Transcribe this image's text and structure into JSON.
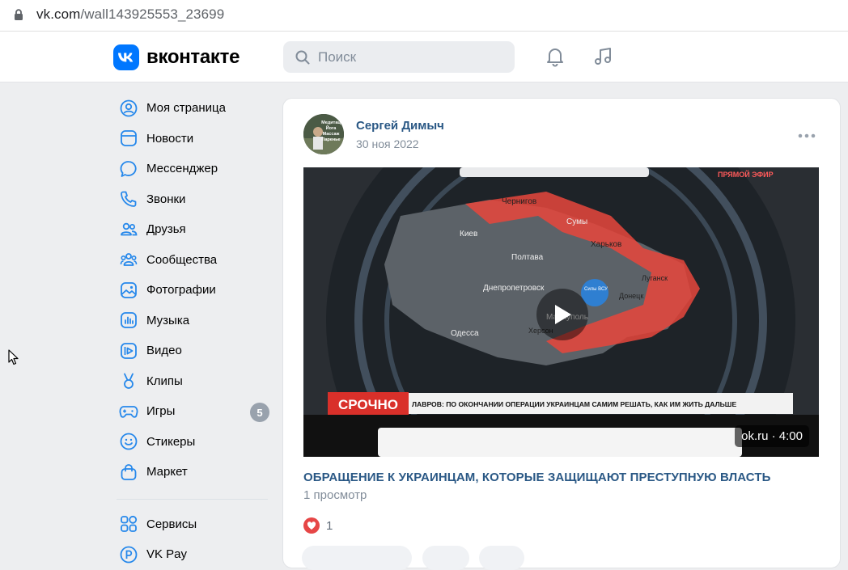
{
  "browser": {
    "url_host": "vk.com",
    "url_path": "/wall143925553_23699"
  },
  "header": {
    "logo_mark": "VK",
    "logo_text": "вконтакте",
    "search_placeholder": "Поиск",
    "icons": [
      "search-icon",
      "bell-icon",
      "music-note-icon"
    ]
  },
  "nav": {
    "items": [
      {
        "label": "Моя страница",
        "icon": "user-circle-icon"
      },
      {
        "label": "Новости",
        "icon": "newsfeed-icon"
      },
      {
        "label": "Мессенджер",
        "icon": "message-icon"
      },
      {
        "label": "Звонки",
        "icon": "phone-icon"
      },
      {
        "label": "Друзья",
        "icon": "friends-icon"
      },
      {
        "label": "Сообщества",
        "icon": "communities-icon"
      },
      {
        "label": "Фотографии",
        "icon": "photo-icon"
      },
      {
        "label": "Музыка",
        "icon": "music-icon"
      },
      {
        "label": "Видео",
        "icon": "video-icon"
      },
      {
        "label": "Клипы",
        "icon": "clips-icon"
      },
      {
        "label": "Игры",
        "icon": "gamepad-icon",
        "badge": "5"
      },
      {
        "label": "Стикеры",
        "icon": "smile-icon"
      },
      {
        "label": "Маркет",
        "icon": "bag-icon"
      }
    ],
    "extra": [
      {
        "label": "Сервисы",
        "icon": "services-icon"
      },
      {
        "label": "VK Pay",
        "icon": "vkpay-icon"
      }
    ]
  },
  "post": {
    "author": "Сергей Димыч",
    "date": "30 ноя 2022",
    "avatar_caption": "Медитац Йога Массаж Паренье",
    "video": {
      "source_duration": "ok.ru · 4:00",
      "overlay_live": "ПРЯМОЙ ЭФИР",
      "overlay_breaking": "СРОЧНО",
      "overlay_ticker": "ЛАВРОВ: ПО ОКОНЧАНИИ ОПЕРАЦИИ УКРАИНЦАМ САМИМ РЕШАТЬ, КАК ИМ ЖИТЬ ДАЛЬШЕ",
      "map_labels": [
        "Чернигов",
        "Сумы",
        "Киев",
        "Харьков",
        "Полтава",
        "Днепропетровск",
        "Луганск",
        "Донецк",
        "Одесса",
        "Мариуполь",
        "Херсон",
        "Силы ВСУ"
      ]
    },
    "title": "ОБРАЩЕНИЕ К УКРАИНЦАМ, КОТОРЫЕ ЗАЩИЩАЮТ ПРЕСТУПНУЮ ВЛАСТЬ",
    "views": "1 просмотр",
    "likes": "1"
  },
  "colors": {
    "accent": "#0077ff",
    "link": "#2a5885",
    "muted": "#818c99",
    "like": "#e64646",
    "background": "#edeef0"
  }
}
